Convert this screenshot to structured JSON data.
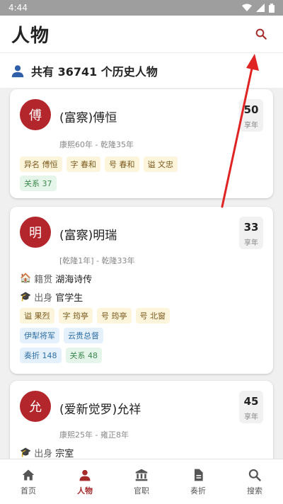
{
  "status_bar": {
    "time": "4:44"
  },
  "header": {
    "title": "人物"
  },
  "summary": {
    "text": "共有 36741 个历史人物"
  },
  "cards": [
    {
      "avatar": "傅",
      "name": "(富察)傅恒",
      "age": "50",
      "age_unit": "享年",
      "dates": "康熙60年 - 乾隆35年",
      "tags": [
        "异名 傅恒",
        "字 春和",
        "号 春和",
        "谥 文忠"
      ],
      "relations": "关系 37"
    },
    {
      "avatar": "明",
      "name": "(富察)明瑞",
      "age": "33",
      "age_unit": "享年",
      "dates": "[乾隆1年] - 乾隆33年",
      "native_label": "籍贯",
      "native_value": "湖海诗传",
      "origin_label": "出身",
      "origin_value": "官学生",
      "tags": [
        "谥 果烈",
        "字 筠亭",
        "号 筠亭",
        "号 北窗"
      ],
      "positions": [
        "伊犁将军",
        "云贵总督"
      ],
      "memorials": "奏折 148",
      "relations": "关系 48"
    },
    {
      "avatar": "允",
      "name": "(爱新觉罗)允祥",
      "age": "45",
      "age_unit": "享年",
      "dates": "康熙25年 - 雍正8年",
      "origin_label": "出身",
      "origin_value": "宗室"
    }
  ],
  "nav": [
    {
      "label": "首页",
      "icon": "home-icon"
    },
    {
      "label": "人物",
      "icon": "person-icon",
      "active": true
    },
    {
      "label": "官职",
      "icon": "bank-icon"
    },
    {
      "label": "奏折",
      "icon": "document-icon"
    },
    {
      "label": "搜索",
      "icon": "search-icon"
    }
  ],
  "colors": {
    "accent": "#a52a2a",
    "avatar": "#b3262b",
    "status_bar": "#9e9e9e",
    "annotation_arrow": "#e02424"
  }
}
